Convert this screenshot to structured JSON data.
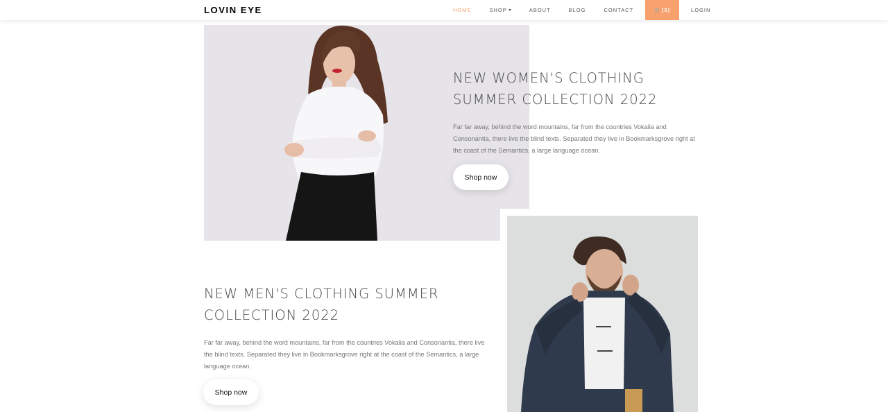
{
  "brand": "LOVIN EYE",
  "nav": {
    "home": "HOME",
    "shop": "SHOP",
    "about": "ABOUT",
    "blog": "BLOG",
    "contact": "CONTACT",
    "cart": "[0]",
    "login": "LOGIN"
  },
  "colors": {
    "accent": "#f8a16c"
  },
  "hero_women": {
    "title": "NEW WOMEN'S CLOTHING SUMMER COLLECTION 2022",
    "text": "Far far away, behind the word mountains, far from the countries Vokalia and Consonantia, there live the blind texts. Separated they live in Bookmarksgrove right at the coast of the Semantics, a large language ocean.",
    "button": "Shop now"
  },
  "hero_men": {
    "title": "NEW MEN'S CLOTHING SUMMER COLLECTION 2022",
    "text": "Far far away, behind the word mountains, far from the countries Vokalia and Consonantia, there live the blind texts. Separated they live in Bookmarksgrove right at the coast of the Semantics, a large language ocean.",
    "button": "Shop now"
  }
}
